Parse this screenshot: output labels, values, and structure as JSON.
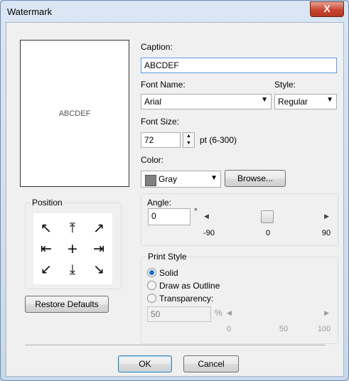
{
  "window": {
    "title": "Watermark",
    "close_label": "X"
  },
  "preview": {
    "text": "ABCDEF"
  },
  "position": {
    "label": "Position",
    "arrows": [
      "↖",
      "⤒",
      "↗",
      "⇤",
      "+",
      "⇥",
      "↙",
      "⤓",
      "↘"
    ]
  },
  "restore_defaults": {
    "label": "Restore Defaults"
  },
  "caption": {
    "label": "Caption:",
    "value": "ABCDEF"
  },
  "font_name": {
    "label": "Font Name:",
    "value": "Arial"
  },
  "style": {
    "label": "Style:",
    "value": "Regular"
  },
  "font_size": {
    "label": "Font Size:",
    "value": "72",
    "range": "pt (6-300)"
  },
  "color": {
    "label": "Color:",
    "value": "Gray",
    "swatch": "#808080",
    "browse_label": "Browse..."
  },
  "angle": {
    "label": "Angle:",
    "value": "0",
    "unit": "°",
    "min": "-90",
    "mid": "0",
    "max": "90",
    "level": 0
  },
  "print_style": {
    "label": "Print Style",
    "solid": "Solid",
    "outline": "Draw as Outline",
    "transparency": "Transparency:",
    "selected": "Solid"
  },
  "transparency": {
    "value": "50",
    "unit": "%",
    "min": "0",
    "mid": "50",
    "max": "100"
  },
  "ok_label": "OK",
  "cancel_label": "Cancel"
}
